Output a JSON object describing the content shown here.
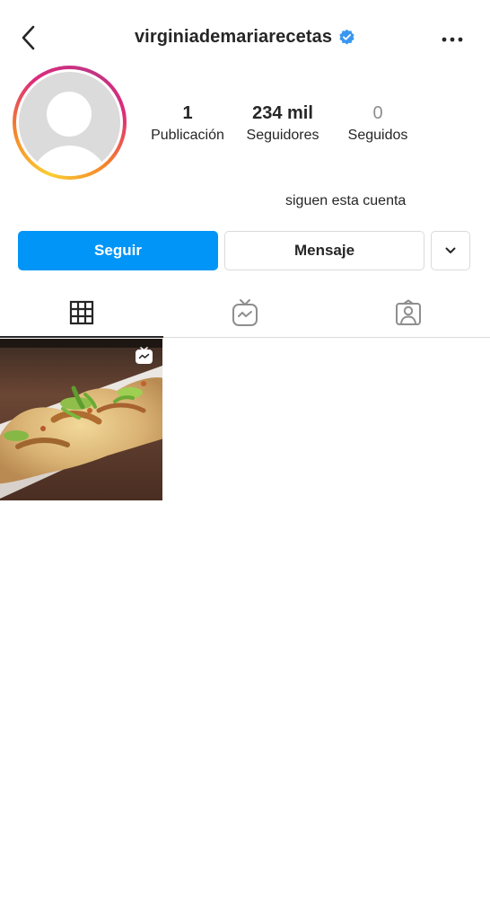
{
  "header": {
    "username": "virginiademariarecetas",
    "verified": true,
    "back_icon": "chevron-left-icon",
    "more_icon": "more-horizontal-icon"
  },
  "profile": {
    "avatar_icon": "default-avatar-icon",
    "stats": {
      "posts": {
        "value": "1",
        "label": "Publicación"
      },
      "followers": {
        "value": "234 mil",
        "label": "Seguidores"
      },
      "following": {
        "value": "0",
        "label": "Seguidos"
      }
    },
    "follow_note": "siguen esta cuenta"
  },
  "actions": {
    "follow_label": "Seguir",
    "message_label": "Mensaje",
    "dropdown_icon": "chevron-down-icon"
  },
  "tabs": [
    {
      "icon": "grid-icon",
      "active": true
    },
    {
      "icon": "igtv-icon",
      "active": false
    },
    {
      "icon": "tagged-icon",
      "active": false
    }
  ],
  "posts": [
    {
      "type": "igtv",
      "thumbnail": "food-photo"
    }
  ],
  "colors": {
    "accent": "#0095f6",
    "text": "#262626",
    "muted": "#8e8e8e",
    "border": "#dbdbdb",
    "verified": "#3897f0"
  }
}
